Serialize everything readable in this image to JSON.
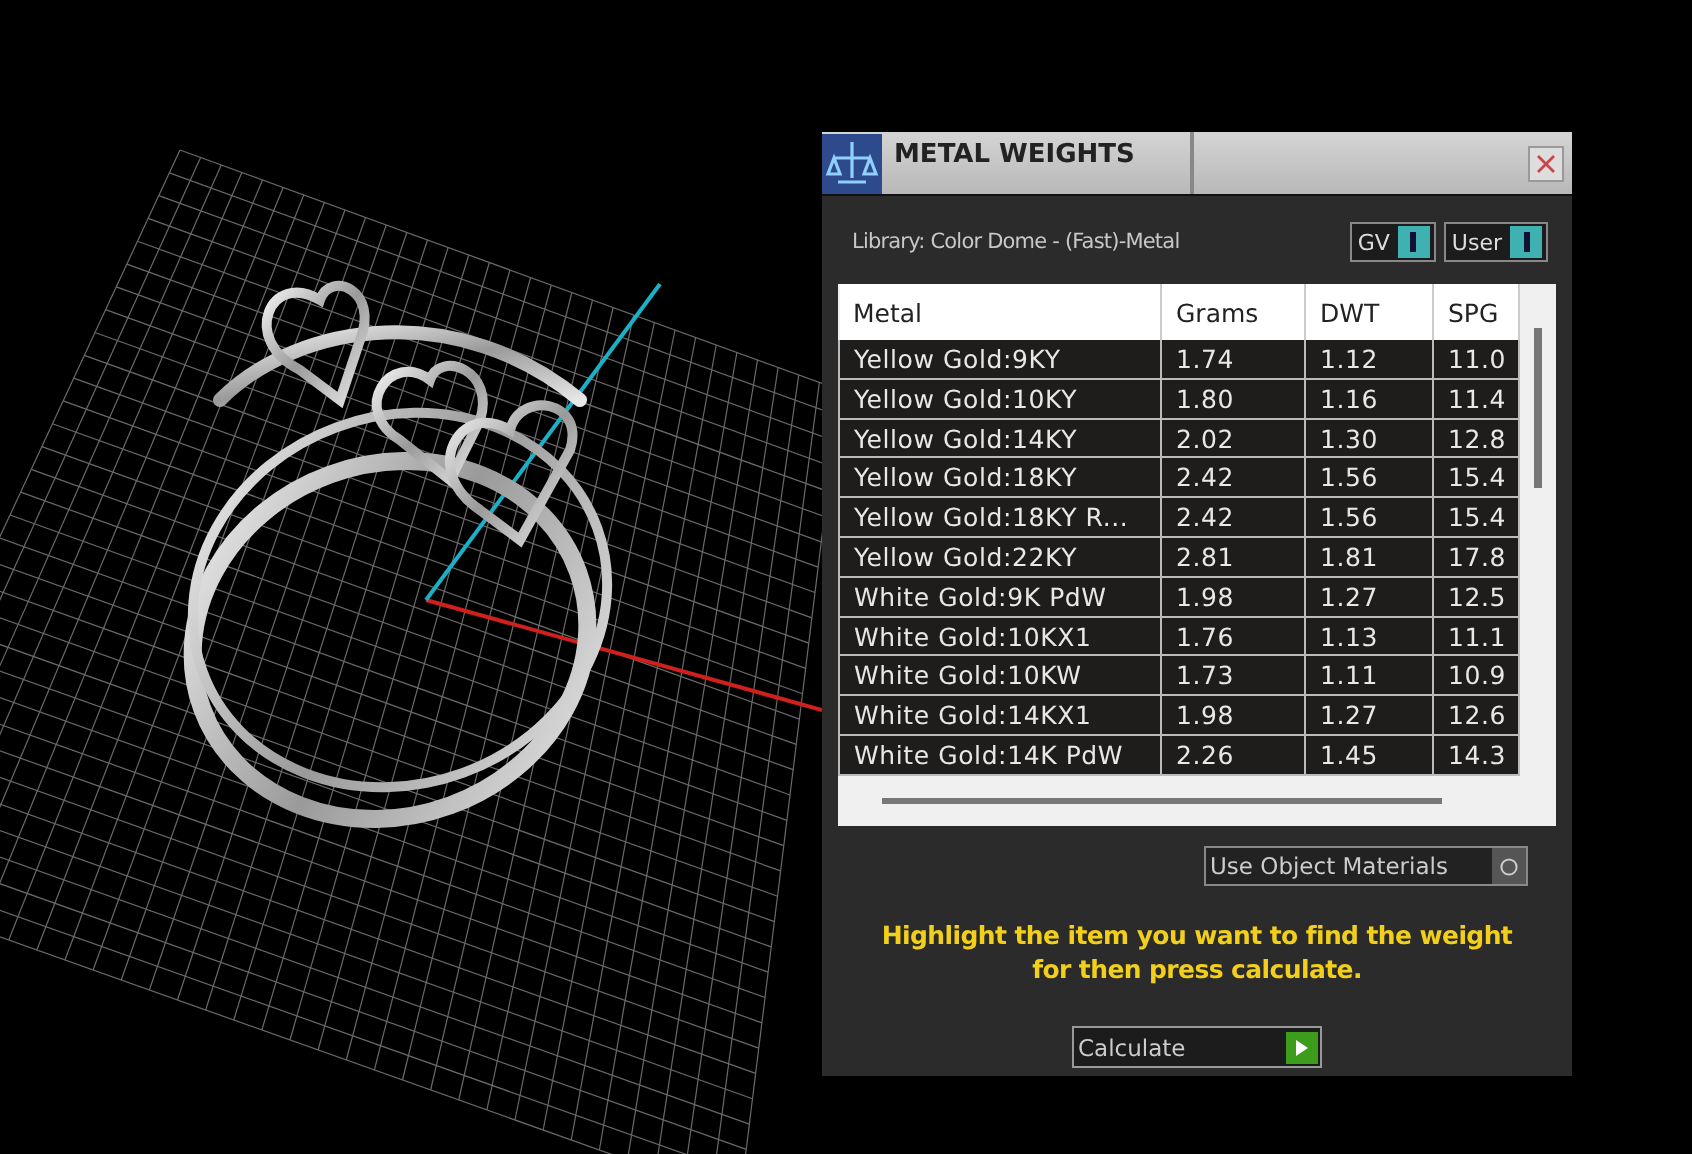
{
  "window": {
    "title": "METAL WEIGHTS"
  },
  "library": {
    "label": "Library: Color Dome - (Fast)-Metal"
  },
  "toggles": [
    {
      "label": "GV",
      "on": true
    },
    {
      "label": "User",
      "on": true
    }
  ],
  "table": {
    "columns": [
      "Metal",
      "Grams",
      "DWT",
      "SPG"
    ],
    "rows": [
      [
        "Yellow Gold:9KY",
        "1.74",
        "1.12",
        "11.0"
      ],
      [
        "Yellow Gold:10KY",
        "1.80",
        "1.16",
        "11.4"
      ],
      [
        "Yellow Gold:14KY",
        "2.02",
        "1.30",
        "12.8"
      ],
      [
        "Yellow Gold:18KY",
        "2.42",
        "1.56",
        "15.4"
      ],
      [
        "Yellow Gold:18KY R...",
        "2.42",
        "1.56",
        "15.4"
      ],
      [
        "Yellow Gold:22KY",
        "2.81",
        "1.81",
        "17.8"
      ],
      [
        "White Gold:9K PdW",
        "1.98",
        "1.27",
        "12.5"
      ],
      [
        "White Gold:10KX1",
        "1.76",
        "1.13",
        "11.1"
      ],
      [
        "White Gold:10KW",
        "1.73",
        "1.11",
        "10.9"
      ],
      [
        "White Gold:14KX1",
        "1.98",
        "1.27",
        "12.6"
      ],
      [
        "White Gold:14K PdW",
        "2.26",
        "1.45",
        "14.3"
      ]
    ]
  },
  "use_object_materials": {
    "label": "Use Object Materials"
  },
  "hint": "Highlight the item you want to find the weight for then press calculate.",
  "calculate_button": {
    "label": "Calculate"
  }
}
